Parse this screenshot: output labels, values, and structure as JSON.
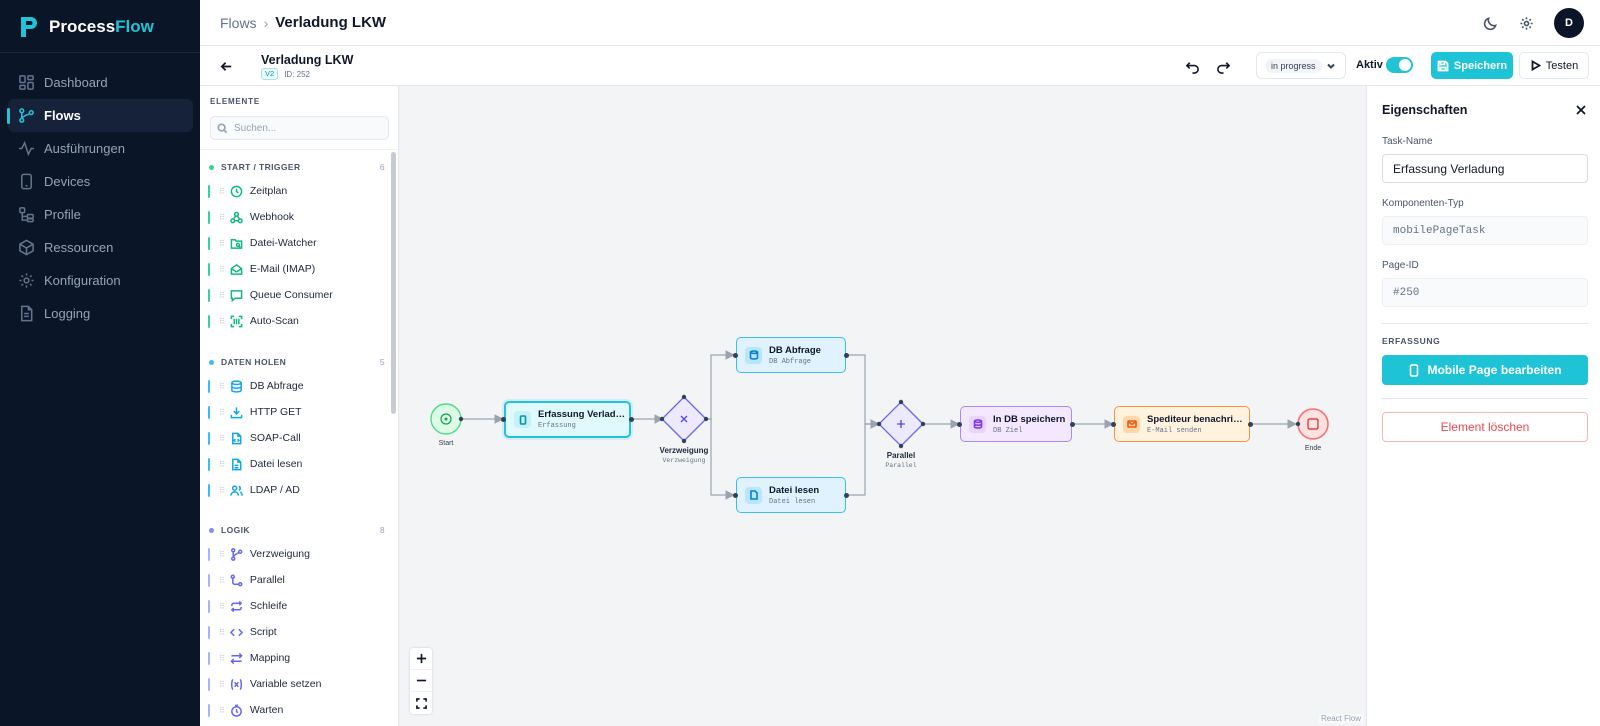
{
  "app": {
    "name_part1": "Process",
    "name_part2": "Flow",
    "brand_color": "#22c3d6",
    "sidebar_bg": "#0b1528"
  },
  "nav": [
    {
      "label": "Dashboard",
      "icon": "dashboard-icon"
    },
    {
      "label": "Flows",
      "icon": "flows-icon",
      "active": true
    },
    {
      "label": "Ausführungen",
      "icon": "activity-icon"
    },
    {
      "label": "Devices",
      "icon": "device-icon"
    },
    {
      "label": "Profile",
      "icon": "profile-icon"
    },
    {
      "label": "Ressourcen",
      "icon": "box-icon"
    },
    {
      "label": "Konfiguration",
      "icon": "gear-icon"
    },
    {
      "label": "Logging",
      "icon": "file-icon"
    }
  ],
  "topbar": {
    "breadcrumb_root": "Flows",
    "breadcrumb_separator": "›",
    "breadcrumb_current": "Verladung LKW",
    "avatar_initial": "D"
  },
  "flow": {
    "name": "Verladung LKW",
    "version": "V2",
    "id_label": "ID: 252",
    "status": "in progress",
    "active_label": "Aktiv",
    "active": true,
    "save_label": "Speichern",
    "test_label": "Testen"
  },
  "palette": {
    "title": "ELEMENTE",
    "search_placeholder": "Suchen...",
    "sections": [
      {
        "title": "START / TRIGGER",
        "count": "6",
        "color": "#34d399",
        "items": [
          {
            "label": "Zeitplan",
            "icon": "clock-icon"
          },
          {
            "label": "Webhook",
            "icon": "webhook-icon"
          },
          {
            "label": "Datei-Watcher",
            "icon": "folder-watch-icon"
          },
          {
            "label": "E-Mail (IMAP)",
            "icon": "mail-icon"
          },
          {
            "label": "Queue Consumer",
            "icon": "message-icon"
          },
          {
            "label": "Auto-Scan",
            "icon": "scan-icon"
          }
        ]
      },
      {
        "title": "DATEN HOLEN",
        "count": "5",
        "color": "#38bdf8",
        "items": [
          {
            "label": "DB Abfrage",
            "icon": "database-icon"
          },
          {
            "label": "HTTP GET",
            "icon": "download-icon"
          },
          {
            "label": "SOAP-Call",
            "icon": "file-code-icon"
          },
          {
            "label": "Datei lesen",
            "icon": "file-icon"
          },
          {
            "label": "LDAP / AD",
            "icon": "users-icon"
          }
        ]
      },
      {
        "title": "LOGIK",
        "count": "8",
        "color": "#818cf8",
        "items": [
          {
            "label": "Verzweigung",
            "icon": "branch-icon"
          },
          {
            "label": "Parallel",
            "icon": "parallel-icon"
          },
          {
            "label": "Schleife",
            "icon": "loop-icon"
          },
          {
            "label": "Script",
            "icon": "code-icon"
          },
          {
            "label": "Mapping",
            "icon": "mapping-icon"
          },
          {
            "label": "Variable setzen",
            "icon": "variable-icon"
          },
          {
            "label": "Warten",
            "icon": "timer-icon"
          }
        ]
      }
    ]
  },
  "canvas": {
    "nodes": {
      "start": {
        "label": "Start"
      },
      "erfassung": {
        "title": "Erfassung Verladung",
        "subtitle": "Erfassung"
      },
      "verzweigung": {
        "title": "Verzweigung",
        "subtitle": "Verzweigung"
      },
      "db_abfrage": {
        "title": "DB Abfrage",
        "subtitle": "DB Abfrage"
      },
      "datei_lesen": {
        "title": "Datei lesen",
        "subtitle": "Datei lesen"
      },
      "parallel": {
        "title": "Parallel",
        "subtitle": "Parallel"
      },
      "db_speichern": {
        "title": "In DB speichern",
        "subtitle": "DB Ziel"
      },
      "spediteur": {
        "title": "Spediteur benachrich…",
        "subtitle": "E-Mail senden"
      },
      "ende": {
        "label": "Ende"
      }
    },
    "attribution": "React Flow"
  },
  "properties": {
    "title": "Eigenschaften",
    "task_name_label": "Task-Name",
    "task_name_value": "Erfassung Verladung",
    "component_type_label": "Komponenten-Typ",
    "component_type_value": "mobilePageTask",
    "page_id_label": "Page-ID",
    "page_id_value": "#250",
    "section_label": "ERFASSUNG",
    "mobile_button": "Mobile Page bearbeiten",
    "delete_button": "Element löschen"
  }
}
